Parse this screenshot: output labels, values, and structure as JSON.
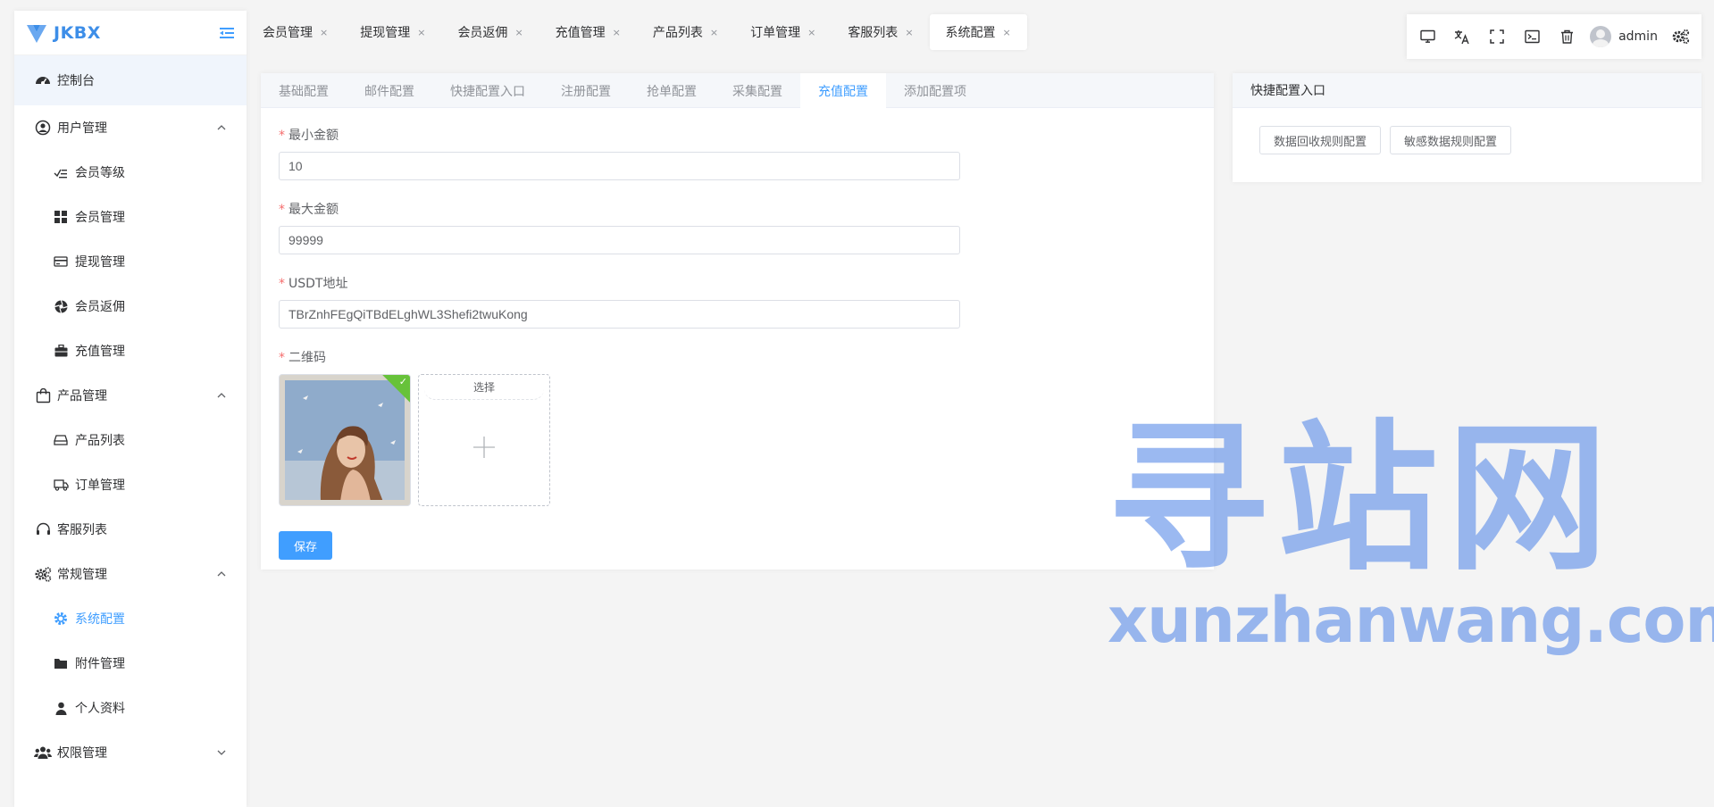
{
  "brand": {
    "name": "JKBX"
  },
  "sidebar": {
    "dashboard": "控制台",
    "groups": [
      {
        "label": "用户管理",
        "items": [
          "会员等级",
          "会员管理",
          "提现管理",
          "会员返佣",
          "充值管理"
        ]
      },
      {
        "label": "产品管理",
        "items": [
          "产品列表",
          "订单管理"
        ]
      },
      {
        "label": "客服列表"
      },
      {
        "label": "常规管理",
        "items": [
          "系统配置",
          "附件管理",
          "个人资料"
        ]
      },
      {
        "label": "权限管理"
      }
    ]
  },
  "top_tabs": [
    "会员管理",
    "提现管理",
    "会员返佣",
    "充值管理",
    "产品列表",
    "订单管理",
    "客服列表",
    "系统配置"
  ],
  "top_tab_close": "×",
  "toolbox": {
    "username": "admin"
  },
  "sub_tabs": [
    "基础配置",
    "邮件配置",
    "快捷配置入口",
    "注册配置",
    "抢单配置",
    "采集配置",
    "充值配置",
    "添加配置项"
  ],
  "form": {
    "req_mark": "*",
    "min_label": "最小金额",
    "min_value": "10",
    "max_label": "最大金额",
    "max_value": "99999",
    "usdt_label": "USDT地址",
    "usdt_value": "TBrZnhFEgQiTBdELghWL3Shefi2twuKong",
    "qr_label": "二维码",
    "image_check": "✓",
    "choose_label": "选择",
    "save_label": "保存"
  },
  "quick_card": {
    "title": "快捷配置入口",
    "buttons": [
      "数据回收规则配置",
      "敏感数据规则配置"
    ]
  },
  "watermark": {
    "big": "寻站网",
    "small": "xunzhanwang.com"
  },
  "colors": {
    "primary": "#409eff",
    "success": "#67c23a",
    "danger": "#f56c6c",
    "brand": "#3d8ee8"
  }
}
